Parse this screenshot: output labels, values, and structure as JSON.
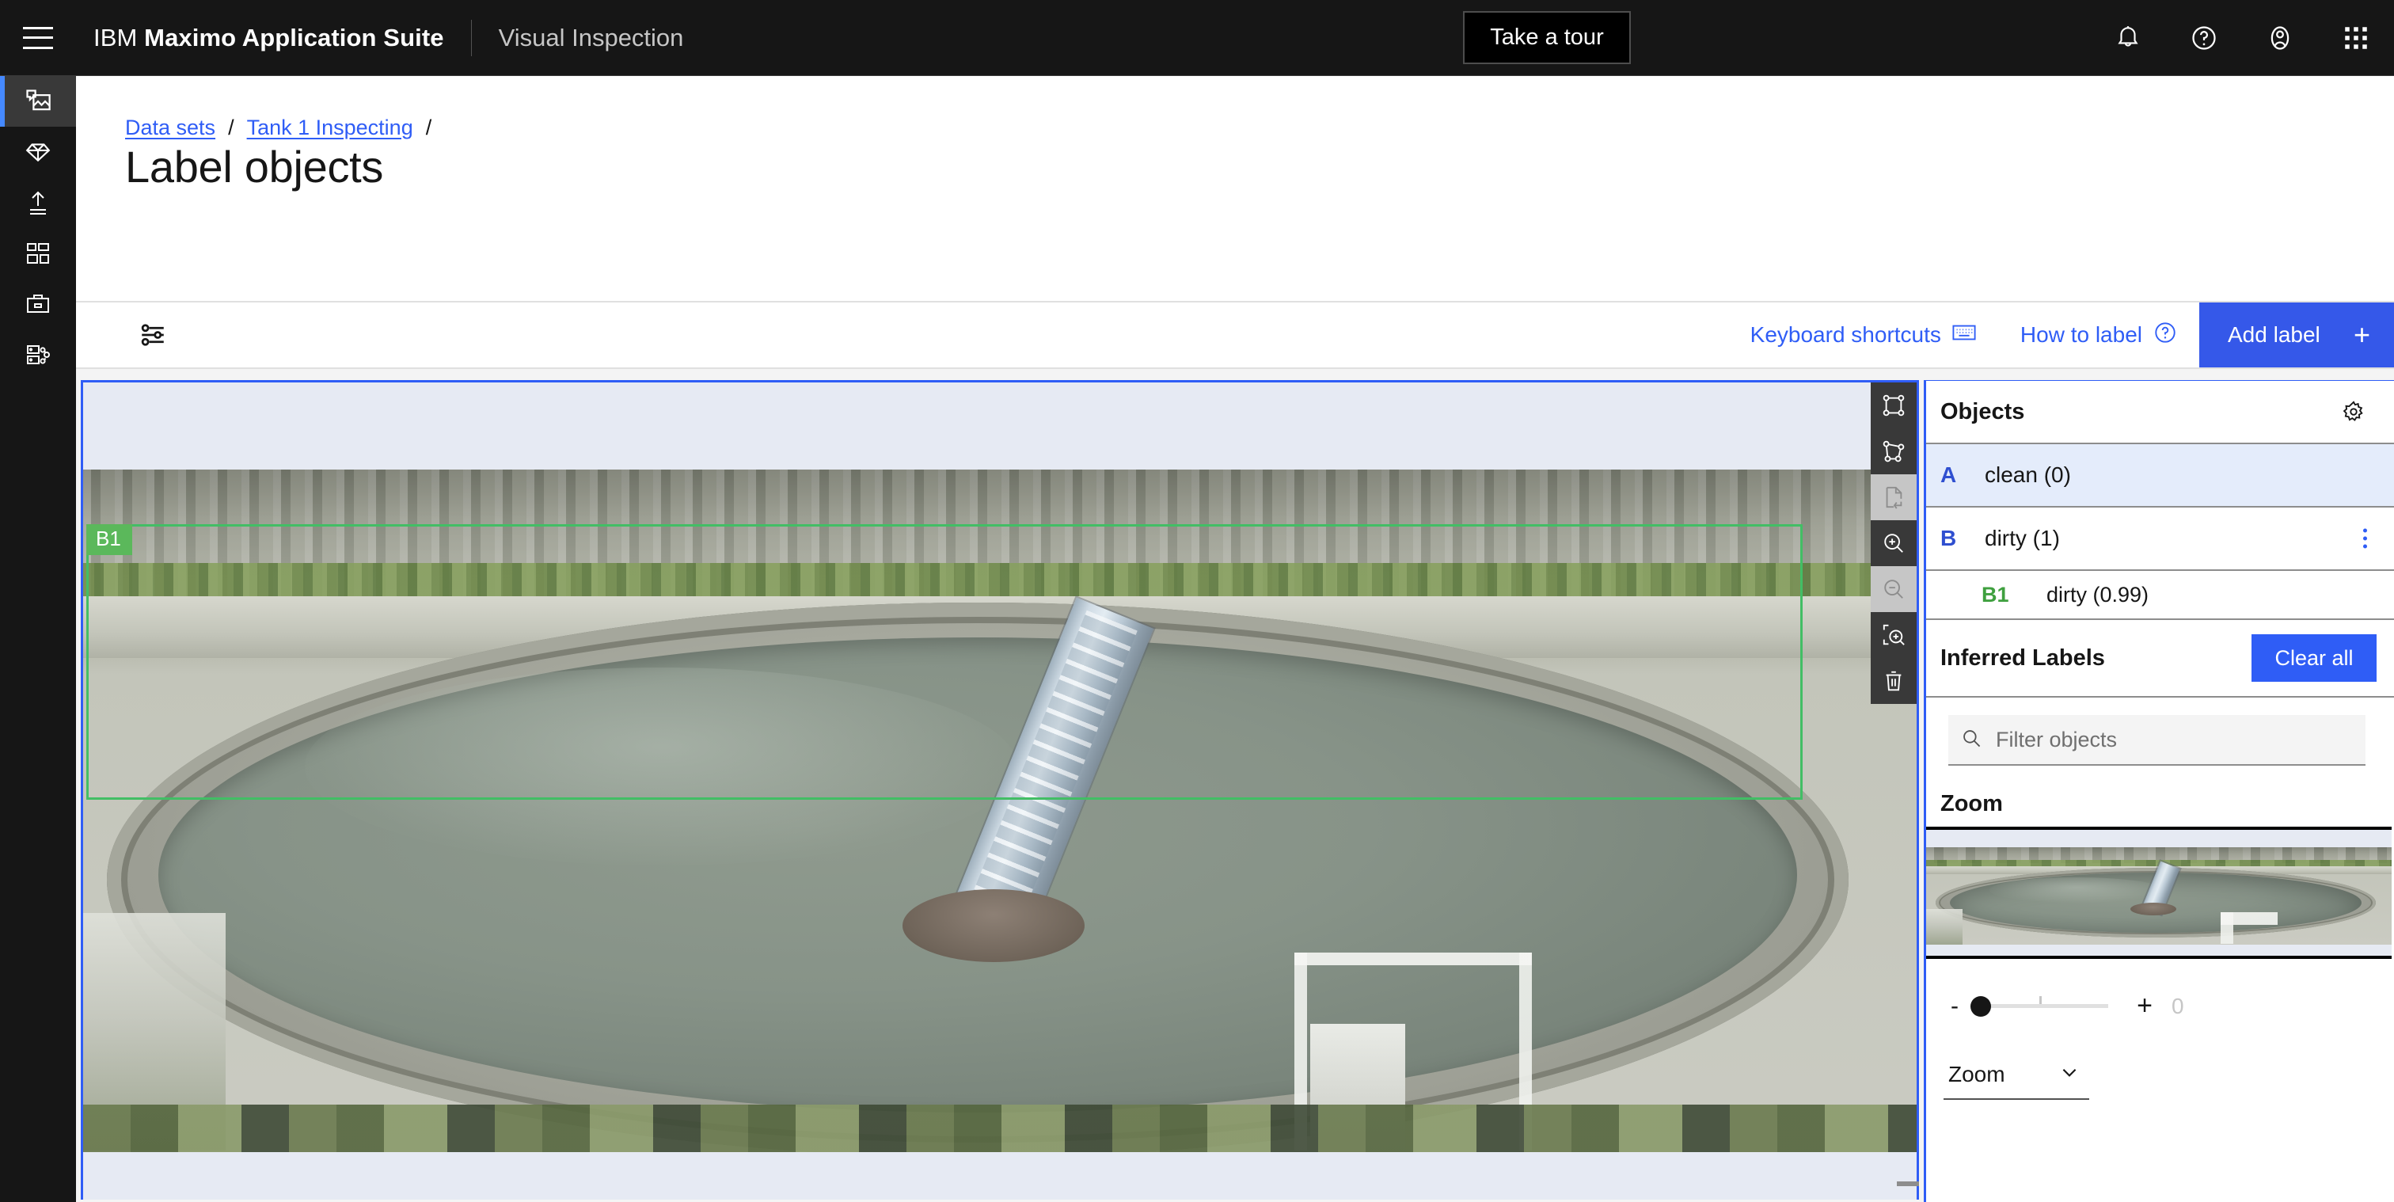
{
  "header": {
    "menu_icon": "hamburger-icon",
    "brand_prefix": "IBM",
    "brand_name": "Maximo Application Suite",
    "product": "Visual Inspection",
    "take_a_tour": "Take a tour",
    "icons": [
      "notification-bell-icon",
      "help-icon",
      "user-avatar-icon",
      "app-switcher-icon"
    ]
  },
  "sidebar": {
    "items": [
      {
        "name": "data-sets",
        "icon": "image-label-icon",
        "active": true
      },
      {
        "name": "models",
        "icon": "diamond-icon",
        "active": false
      },
      {
        "name": "deploy",
        "icon": "upload-icon",
        "active": false
      },
      {
        "name": "dashboard",
        "icon": "grid-icon",
        "active": false
      },
      {
        "name": "projects",
        "icon": "briefcase-icon",
        "active": false
      },
      {
        "name": "data-share",
        "icon": "data-share-icon",
        "active": false
      }
    ]
  },
  "breadcrumb": {
    "items": [
      "Data sets",
      "Tank 1 Inspecting"
    ],
    "separator": "/"
  },
  "page": {
    "title": "Label objects"
  },
  "toolbar": {
    "settings_icon": "sliders-icon",
    "keyboard_shortcuts": "Keyboard shortcuts",
    "keyboard_icon": "keyboard-icon",
    "how_to_label": "How to label",
    "help_icon": "help-circle-icon",
    "add_label": "Add label",
    "add_label_plus": "+"
  },
  "canvas": {
    "tools": [
      {
        "name": "bounding-box-tool",
        "label": "Box",
        "disabled": false
      },
      {
        "name": "polygon-tool",
        "label": "Polygon",
        "disabled": false
      },
      {
        "name": "undo-tool",
        "label": "Undo",
        "disabled": true
      },
      {
        "name": "zoom-in-tool",
        "label": "Zoom in",
        "disabled": false
      },
      {
        "name": "zoom-out-tool",
        "label": "Zoom out",
        "disabled": true
      },
      {
        "name": "zoom-to-selection-tool",
        "label": "Zoom to selection",
        "disabled": false
      },
      {
        "name": "delete-tool",
        "label": "Delete",
        "disabled": false
      }
    ],
    "bbox_label": "B1",
    "bbox_color": "#42be65"
  },
  "objects_panel": {
    "title": "Objects",
    "gear_icon": "gear-icon",
    "rows": [
      {
        "key": "A",
        "label": "clean (0)",
        "selected": true,
        "kebab": false
      },
      {
        "key": "B",
        "label": "dirty (1)",
        "selected": false,
        "kebab": true
      }
    ],
    "sub_rows": [
      {
        "key": "B1",
        "label": "dirty (0.99)"
      }
    ]
  },
  "inferred": {
    "title": "Inferred Labels",
    "clear_all": "Clear all"
  },
  "filter": {
    "icon": "search-icon",
    "placeholder": "Filter objects",
    "value": ""
  },
  "zoom": {
    "title": "Zoom",
    "minus": "-",
    "plus": "+",
    "value": "0",
    "select_label": "Zoom",
    "chevron_icon": "chevron-down-icon"
  },
  "colors": {
    "accent_blue": "#2f5df6",
    "brand_blue": "#3558e9",
    "header_black": "#161616",
    "bbox_green": "#42be65",
    "canvas_bg": "#e6eaf3"
  }
}
